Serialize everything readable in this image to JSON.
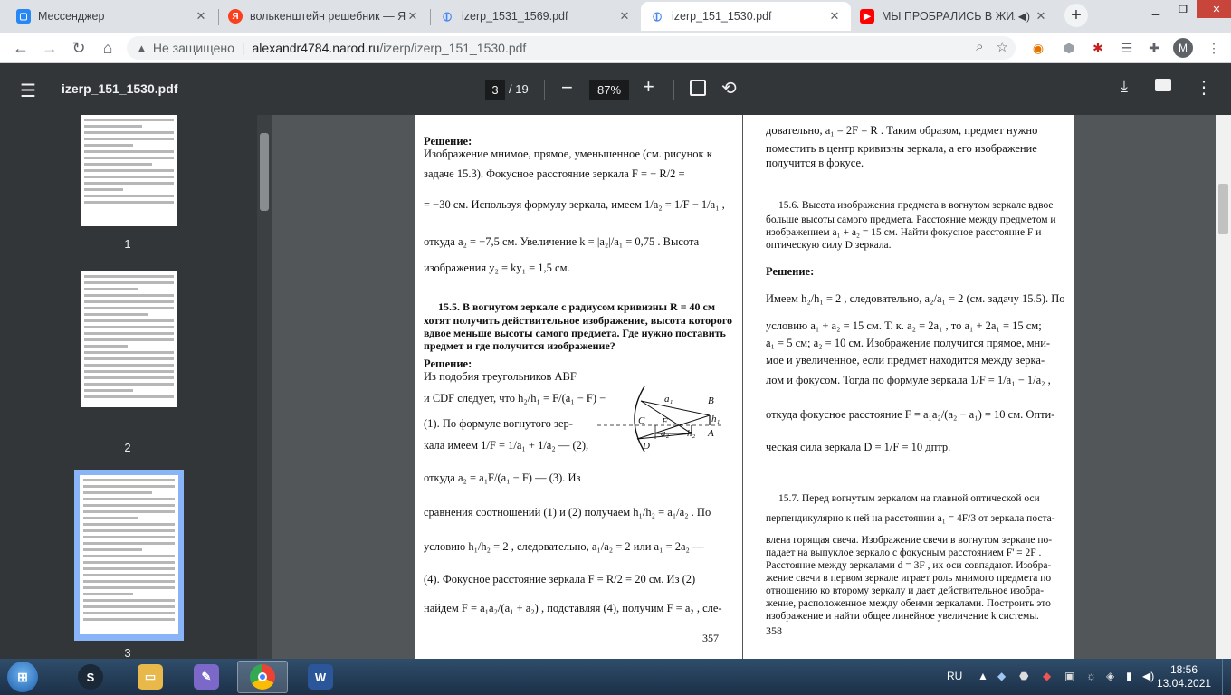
{
  "browser": {
    "tabs": [
      {
        "title": "Мессенджер",
        "icon": "messenger-icon",
        "color": "#2787f5"
      },
      {
        "title": "волькенштейн решебник — Ян",
        "icon": "yandex-icon",
        "color": "#fc3f1d"
      },
      {
        "title": "izerp_1531_1569.pdf",
        "icon": "pdf-icon",
        "color": "#4285f4"
      },
      {
        "title": "izerp_151_1530.pdf",
        "icon": "pdf-icon",
        "color": "#4285f4"
      },
      {
        "title": "МЫ ПРОБРАЛИСЬ В ЖИЛ",
        "icon": "youtube-icon",
        "color": "#ff0000"
      }
    ],
    "address": {
      "security": "Не защищено",
      "host": "alexandr4784.narod.ru",
      "path": "/izerp/izerp_151_1530.pdf"
    },
    "profile_initial": "M"
  },
  "pdf": {
    "filename": "izerp_151_1530.pdf",
    "current_page": "3",
    "total_pages": "/ 19",
    "zoom": "87%",
    "thumbnails": [
      "1",
      "2",
      "3"
    ]
  },
  "document": {
    "left": {
      "l1": "Решение:",
      "l2": "Изображение мнимое, прямое, уменьшенное (см. рисунок к",
      "l3": "задаче  15.3).  Фокусное расстояние  зеркала   F = − R/2 =",
      "l4": "= −30 см. Используя формулу зеркала, имеем   1/a₂ = 1/F − 1/a₁ ,",
      "l5": "откуда   a₂ = −7,5 см.    Увеличение   k = |a₂|/a₁ = 0,75 .   Высота",
      "l6": "изображения   y₂ = ky₁ = 1,5 см.",
      "l7": "15.5. В вогнутом зеркале с радиусом кривизны  R = 40 см",
      "l8": "хотят получить действительное изображение, высота которого",
      "l9": "вдвое меньше высоты самого предмета. Где нужно поставить",
      "l10": "предмет и где получится изображение?",
      "l11": "Решение:",
      "l12": "Из подобия треугольников  ABF",
      "l13": "и CDF  следует, что  h₂/h₁ = F/(a₁ − F)  −",
      "l14": "(1). По формуле вогнутого зер-",
      "l15": "кала  имеем   1/F = 1/a₁ + 1/a₂   —  (2),",
      "l16": "откуда   a₂ = a₁F/(a₁ − F)   —  (3).   Из",
      "l17": "сравнения  соотношений  (1)  и  (2)  получаем   h₁/h₂ = a₁/a₂ .  По",
      "l18": "условию   h₁/h₂ = 2 ,  следовательно,   a₁/a₂ = 2   или   a₁ = 2a₂  —",
      "l19": "(4).  Фокусное  расстояние  зеркала   F = R/2 = 20 см.   Из  (2)",
      "l20": "найдем   F = a₁a₂/(a₁ + a₂) ,  подставляя  (4),  получим   F = a₂ ,  сле-",
      "page_number": "357"
    },
    "right": {
      "r1": "довательно,   a₁ = 2F = R .  Таким образом,  предмет  нужно",
      "r2": "поместить  в  центр  кривизны  зеркала,  а  его  изображение",
      "r3": "получится в фокусе.",
      "r4": "15.6. Высота изображения предмета в вогнутом зеркале вдвое",
      "r5": "больше высоты самого предмета. Расстояние между предметом и",
      "r6": "изображением   a₁ + a₂ = 15 см.  Найти фокусное расстояние  F  и",
      "r7": "оптическую силу  D  зеркала.",
      "r8": "Решение:",
      "r9": "Имеем  h₂/h₁ = 2 , следовательно,  a₂/a₁ = 2  (см. задачу 15.5). По",
      "r10": "условию   a₁ + a₂ = 15 см.  Т. к.   a₂ = 2a₁ ,  то   a₁ + 2a₁ = 15 см;",
      "r11": "a₁ = 5 см;   a₂ = 10 см.  Изображение получится прямое, мни-",
      "r12": "мое и увеличенное, если предмет находится между зерка-",
      "r13": "лом  и  фокусом.  Тогда  по  формуле  зеркала    1/F = 1/a₁ − 1/a₂ ,",
      "r14": "откуда   фокусное   расстояние    F = a₁a₂/(a₂ − a₁) = 10 см.    Опти-",
      "r15": "ческая сила зеркала   D = 1/F = 10 дптр.",
      "r16": "15.7.  Перед  вогнутым  зеркалом  на  главной  оптической  оси",
      "r17": "перпендикулярно к ней на расстоянии   a₁ = 4F/3   от зеркала поста-",
      "r18": "влена горящая свеча. Изображение свечи в вогнутом зеркале по-",
      "r19": "падает на выпуклое зеркало с фокусным расстоянием   F' = 2F .",
      "r20": "Расстояние между зеркалами   d = 3F , их оси совпадают. Изобра-",
      "r21": "жение свечи в первом зеркале играет роль мнимого предмета по",
      "r22": "отношению ко второму зеркалу и дает действительное изобра-",
      "r23": "жение, расположенное между обеими зеркалами. Построить это",
      "r24": "изображение и найти общее линейное увеличение   k   системы.",
      "page_number": "358"
    },
    "figure_labels": {
      "a1": "a₁",
      "B": "B",
      "C": "C",
      "F": "F",
      "h1": "h₁",
      "a2": "a₂",
      "h2": "h₂",
      "A": "A",
      "D": "D"
    }
  },
  "taskbar": {
    "apps": [
      {
        "icon": "steam-icon",
        "color": "#1b2838",
        "glyph": "S"
      },
      {
        "icon": "file-explorer-icon",
        "color": "#e8b84a",
        "glyph": "▭"
      },
      {
        "icon": "paint-icon",
        "color": "#7b68c8",
        "glyph": "✎"
      },
      {
        "icon": "chrome-icon",
        "color": "#34a853",
        "glyph": "●"
      },
      {
        "icon": "word-icon",
        "color": "#2b579a",
        "glyph": "W"
      }
    ],
    "language": "RU",
    "time": "18:56",
    "date": "13.04.2021"
  }
}
